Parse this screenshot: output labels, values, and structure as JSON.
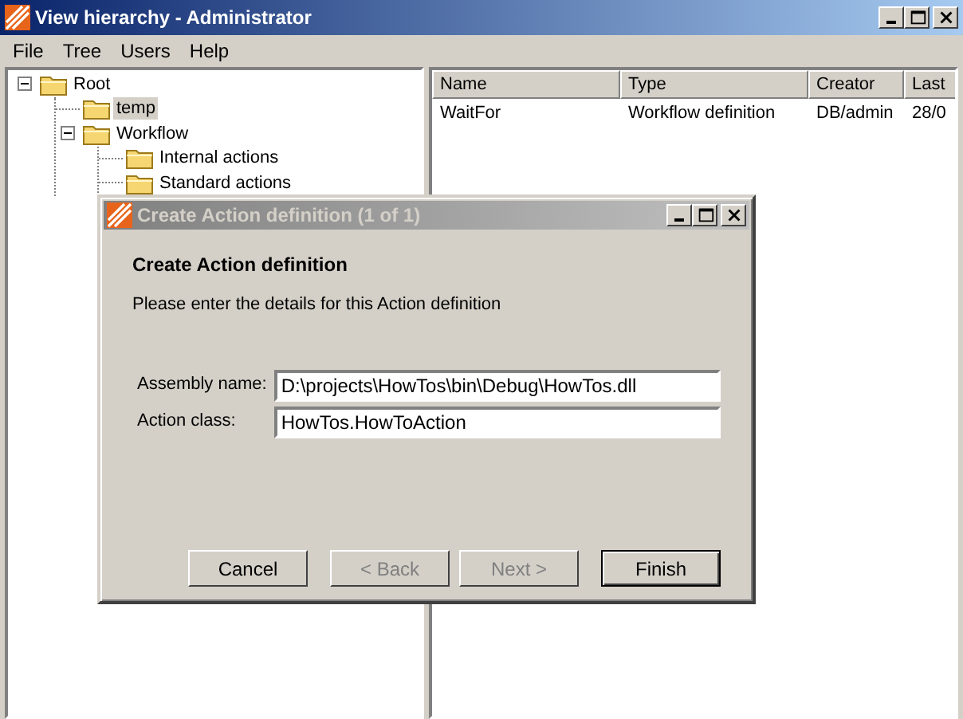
{
  "window": {
    "title": "View hierarchy - Administrator"
  },
  "menu": [
    "File",
    "Tree",
    "Users",
    "Help"
  ],
  "tree": [
    {
      "label": "Root",
      "expanded": true,
      "selected": false,
      "children": [
        {
          "label": "temp",
          "selected": true
        },
        {
          "label": "Workflow",
          "expanded": true,
          "selected": false,
          "children": [
            {
              "label": "Internal actions",
              "selected": false
            },
            {
              "label": "Standard actions",
              "selected": false
            }
          ]
        }
      ]
    }
  ],
  "table": {
    "columns": [
      "Name",
      "Type",
      "Creator",
      "Last"
    ],
    "rows": [
      [
        "WaitFor",
        "Workflow definition",
        "DB/admin",
        "28/0"
      ]
    ]
  },
  "dialog": {
    "title": "Create Action definition (1 of 1)",
    "active": false,
    "heading": "Create Action definition",
    "description": "Please enter the details for this Action definition",
    "fields": [
      {
        "label": "Assembly name:",
        "value": "D:\\projects\\HowTos\\bin\\Debug\\HowTos.dll"
      },
      {
        "label": "Action class:",
        "value": "HowTos.HowToAction"
      }
    ],
    "buttons": [
      {
        "label": "Cancel",
        "disabled": false,
        "default": false
      },
      {
        "label": "< Back",
        "disabled": true,
        "default": false
      },
      {
        "label": "Next >",
        "disabled": true,
        "default": false
      },
      {
        "label": "Finish",
        "disabled": false,
        "default": true
      }
    ]
  }
}
